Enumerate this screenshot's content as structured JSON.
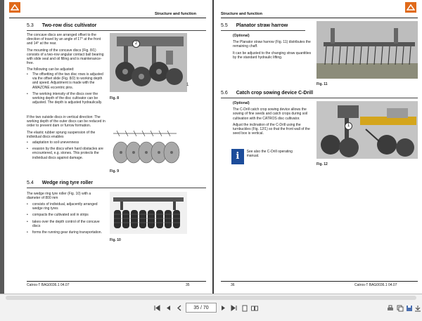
{
  "left_page": {
    "header_title": "",
    "section_5_3": {
      "number": "5.3",
      "title": "Two-row disc cultivator"
    },
    "text_5_3": [
      "The concave discs are arranged offset to the direction of travel by an angle of 17° at the front and 14° at the rear.",
      "The mounting of the concave discs (Fig. 8/1) consists of a two-row angular contact ball bearing with slide seal and oil filling and is maintenance-free.",
      "The following can be adjusted:"
    ],
    "bullets_adjust": [
      "The offsetting of the two disc rows is adjusted via the offset slide (Fig. 8/2) to working depth and speed. Adjustment is made with the AMAZONE eccentric pins.",
      "The working intensity of the discs over the working depth of the disc cultivator can be adjusted. The depth is adjusted hydraulically."
    ],
    "text_outside": "If the two outside discs in vertical direction: The working depth of the outer discs can be reduced in order to prevent dam or furrow formation.",
    "text_elastic": "The elastic rubber sprung suspension of the individual discs enables",
    "bullets_elastic": [
      "adaptation to soil unevenness",
      "evasion by the discs when hard obstacles are encountered, e.g. stones. This protects the individual discs against damage."
    ],
    "fig8_caption": "Fig. 8",
    "fig9_caption": "Fig. 9",
    "fig8_callout_1": "2",
    "fig8_callout_2": "1",
    "section_5_4": {
      "number": "5.4",
      "title": "Wedge ring tyre roller"
    },
    "text_5_4": "The wedge ring tyre roller (Fig. 10) with a diameter of 800 mm",
    "bullets_roller": [
      "consists of individual, adjacently arranged wedge ring tyres",
      "compacts the cultivated soil in strips",
      "takes over the depth control of the concave discs",
      "forms the running gear during transportation."
    ],
    "fig10_caption": "Fig. 10",
    "footer_doc": "Catros-T  BAG0036.1  04.07",
    "footer_page": "35"
  },
  "right_page": {
    "header_title": "Structure and function",
    "section_5_5": {
      "number": "5.5",
      "title": "Planator straw harrow"
    },
    "optional_1": "(Optional)",
    "text_5_5": [
      "The Planator straw harrow (Fig. 11) distributes the remaining chaff.",
      "It can be adjusted to the changing straw quantities by the standard hydraulic lifting."
    ],
    "fig11_caption": "Fig. 11",
    "section_5_6": {
      "number": "5.6",
      "title": "Catch crop sowing device C-Drill"
    },
    "optional_2": "(Optional)",
    "text_5_6": [
      "The C-Drill catch crop sowing device allows the sowing of fine seeds and catch crops during soil cultivation with the CATROS disc cultivator.",
      "Adjust the inclination of the C-Drill using the turnbuckles (Fig. 12/1) so that the front wall of the seed box is vertical."
    ],
    "info_text": "See also the C-Drill operating manual.",
    "info_icon": "i",
    "fig12_caption": "Fig. 12",
    "fig12_callout": "1",
    "footer_page": "36",
    "footer_doc": "Catros-T  BAG0036.1  04.07"
  },
  "left_header": "Structure and function",
  "toolbar": {
    "page_indicator": "35 / 70",
    "icons": [
      "first-page-icon",
      "prev-page-icon",
      "next-page-icon",
      "last-page-icon",
      "single-page-icon",
      "two-page-icon",
      "print-icon",
      "copy-icon",
      "zoom-icon",
      "save-icon",
      "fit-icon",
      "download-icon"
    ]
  },
  "colors": {
    "brand": "#e06a1a",
    "info": "#1c4c9a"
  }
}
